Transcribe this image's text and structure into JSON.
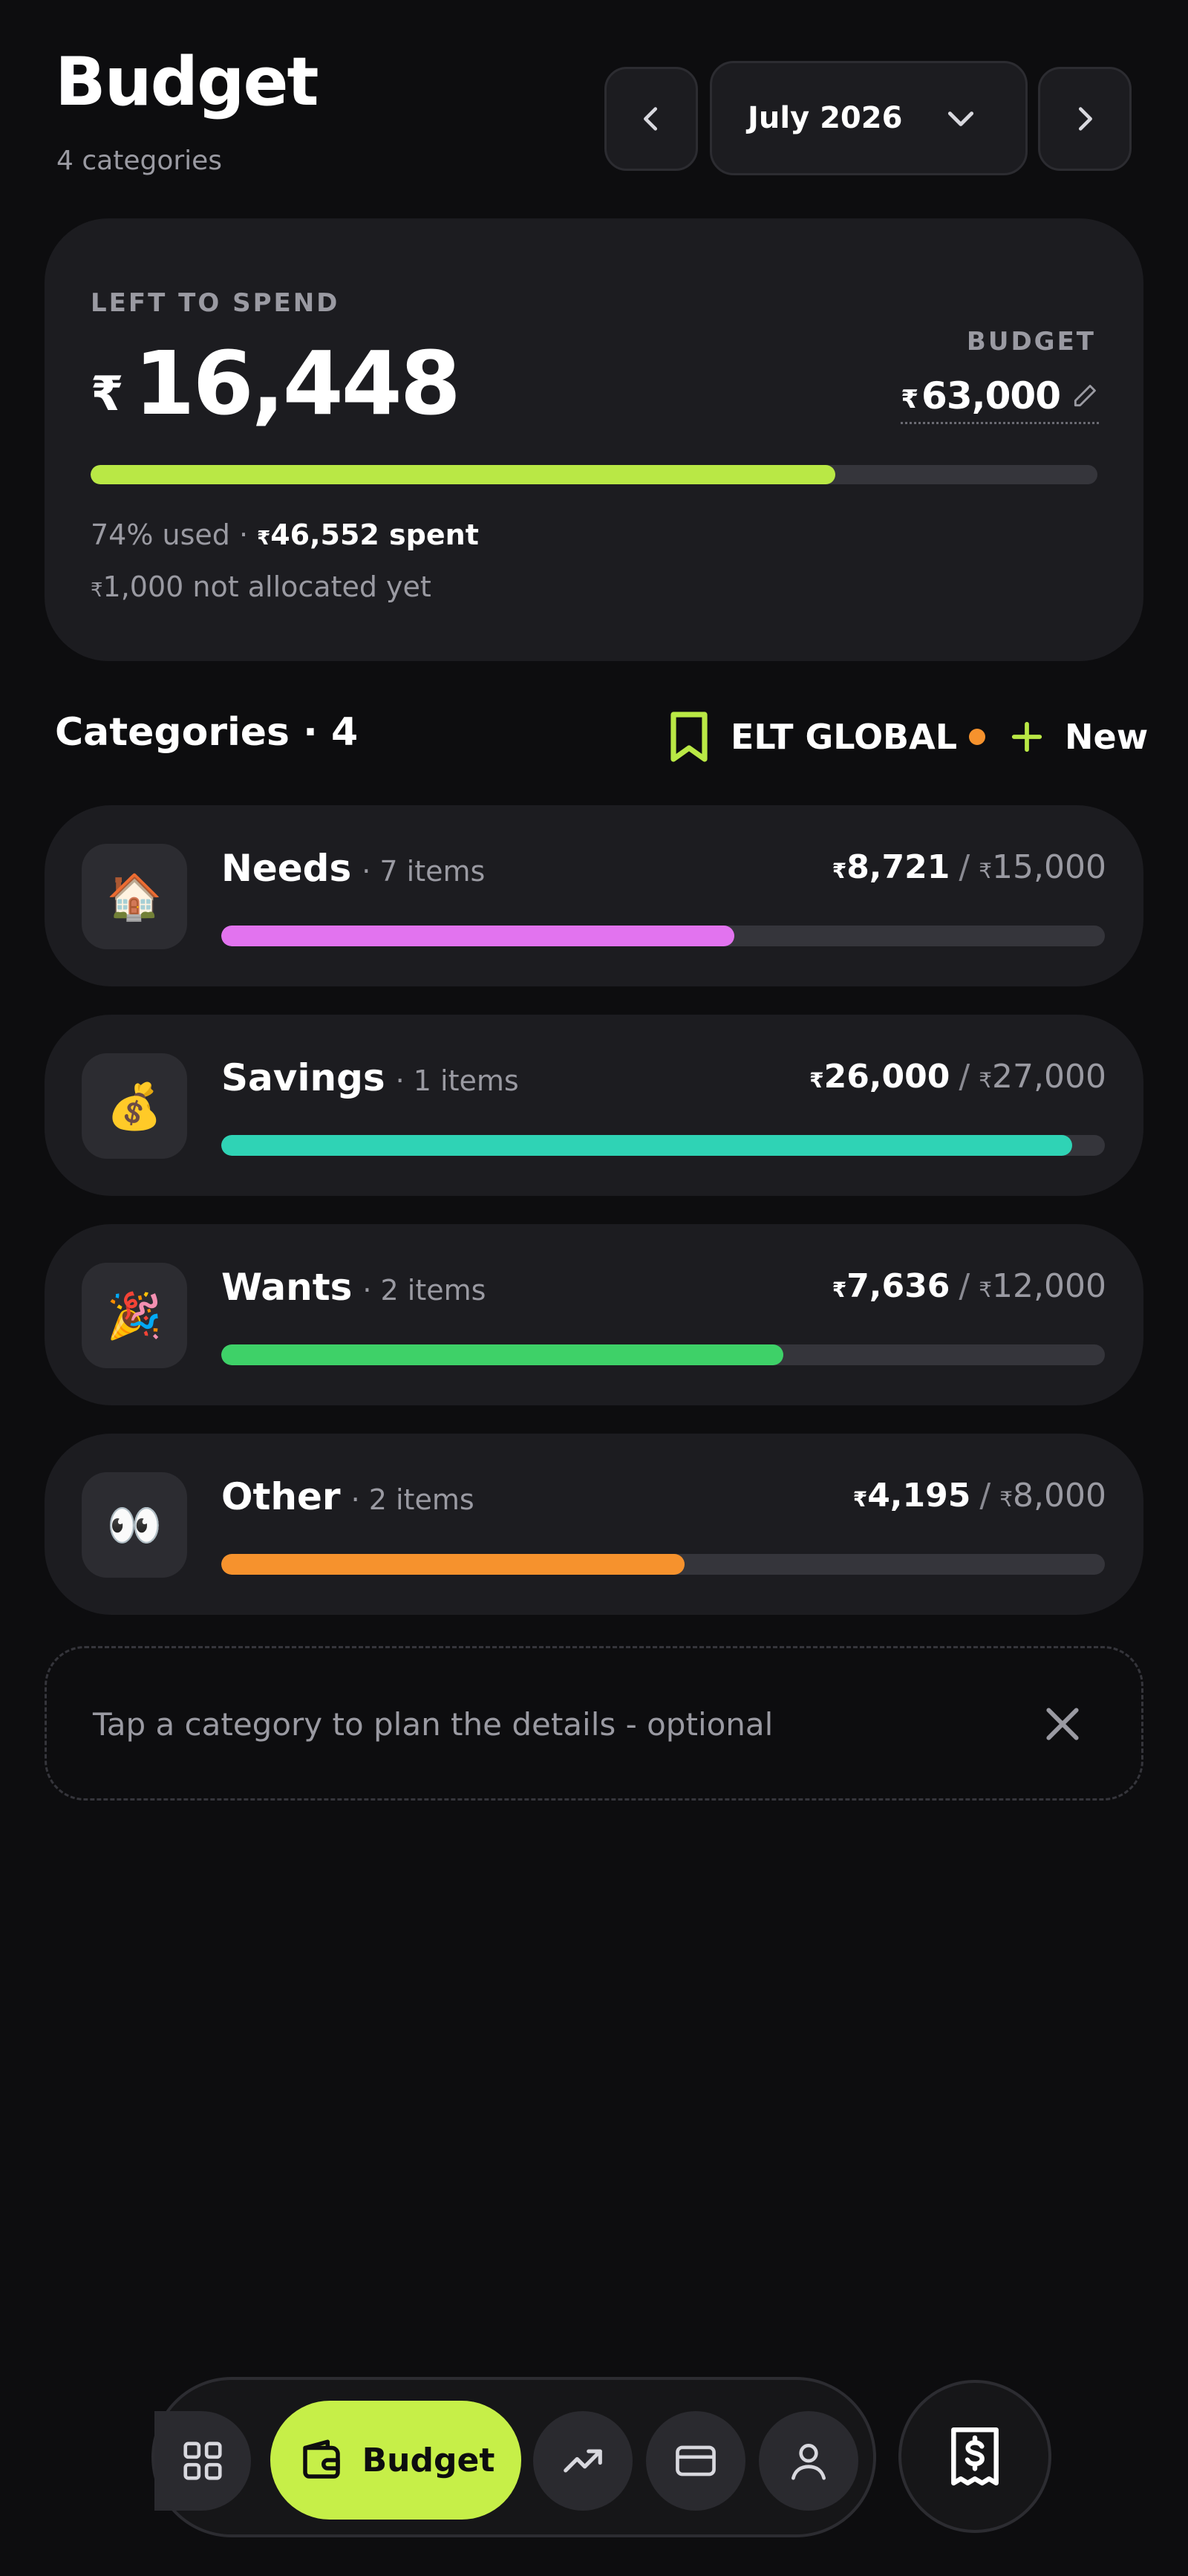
{
  "header": {
    "title": "Budget",
    "subtitle": "4 categories",
    "month": "July 2026"
  },
  "summary": {
    "left_label": "LEFT TO SPEND",
    "currency": "₹",
    "left_amount": "16,448",
    "budget_label": "BUDGET",
    "budget_amount": "63,000",
    "used_fraction": 0.74,
    "used_text": "74% used ·",
    "spent_amount": "46,552",
    "spent_suffix": " spent",
    "unallocated_amount": "1,000",
    "unallocated_suffix": " not allocated yet",
    "bar_color": "#b9e845"
  },
  "categories_header": {
    "title": "Categories · 4",
    "project_name": "ELT GLOBAL",
    "project_dot_color": "#f6922d",
    "new_label": "New"
  },
  "categories": [
    {
      "emoji": "🏠",
      "name": "Needs",
      "count": "· 7 items",
      "spent": "8,721",
      "budget": "15,000",
      "fraction": 0.581,
      "color": "#e273ef"
    },
    {
      "emoji": "💰",
      "name": "Savings",
      "count": "· 1 items",
      "spent": "26,000",
      "budget": "27,000",
      "fraction": 0.963,
      "color": "#2fd3b5"
    },
    {
      "emoji": "🎉",
      "name": "Wants",
      "count": "· 2 items",
      "spent": "7,636",
      "budget": "12,000",
      "fraction": 0.636,
      "color": "#3ed168"
    },
    {
      "emoji": "👀",
      "name": "Other",
      "count": "· 2 items",
      "spent": "4,195",
      "budget": "8,000",
      "fraction": 0.524,
      "color": "#f6922d"
    }
  ],
  "tip": {
    "text": "Tap a category to plan the details - optional"
  },
  "bottom_nav": {
    "active_label": "Budget",
    "active_color": "#c6ef48",
    "icons": [
      "grid-icon",
      "wallet-icon",
      "trend-up-icon",
      "credit-card-icon",
      "user-icon",
      "receipt-icon"
    ]
  }
}
